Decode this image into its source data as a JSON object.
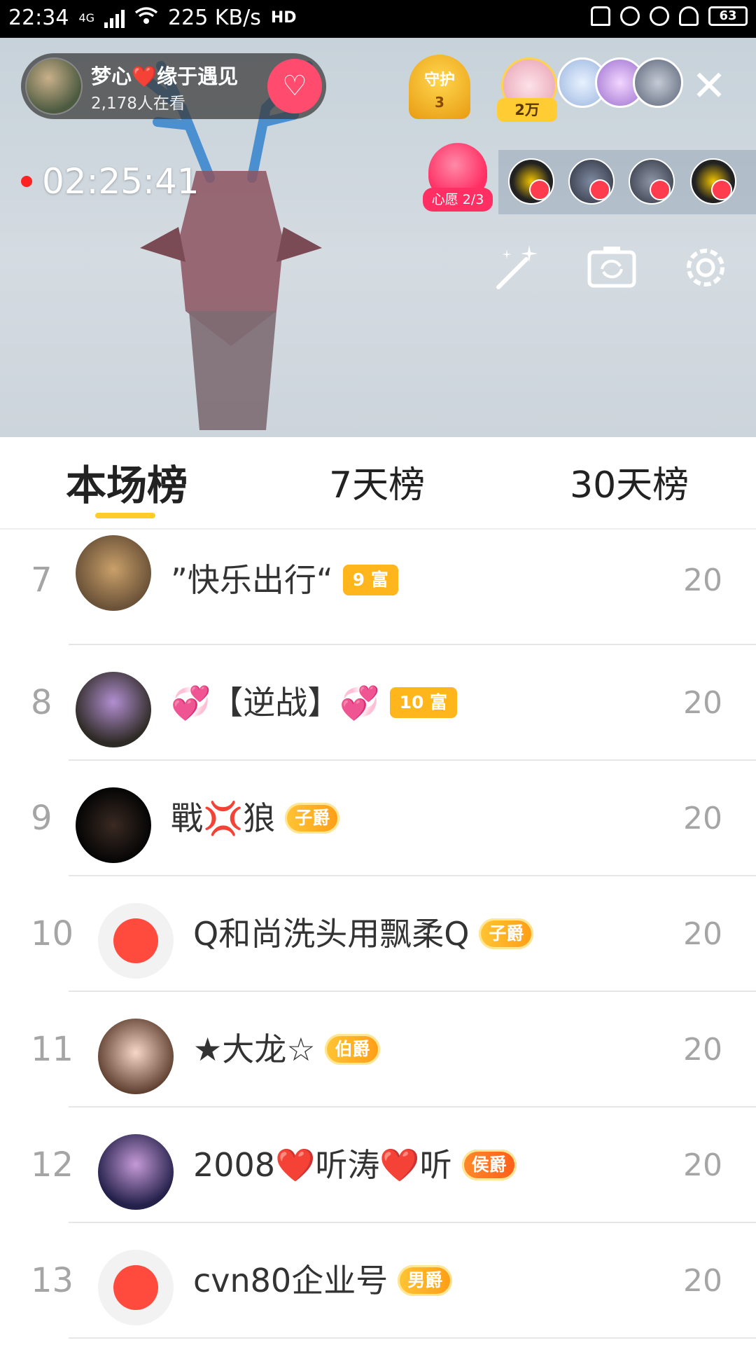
{
  "status_bar": {
    "time": "22:34",
    "network": "4G",
    "speed": "225 KB/s",
    "hd_label": "HD",
    "battery": "63",
    "icons": [
      "mute-icon",
      "lock-rotation-icon",
      "alarm-icon",
      "headphones-icon",
      "battery-icon"
    ]
  },
  "live": {
    "anchor_name": "梦心❤️缘于遇见",
    "viewers": "2,178人在看",
    "follow_icon": "heart-plus-icon",
    "guard_label": "守护",
    "guard_count": "3",
    "fan_count": "2万",
    "timer": "02:25:41",
    "wish_label": "心愿 2/3",
    "tools": [
      "magic-wand-icon",
      "camera-flip-icon",
      "settings-gear-icon"
    ],
    "colors": {
      "accent": "#ffcc29",
      "live_red": "#ff2f63"
    }
  },
  "tabs": [
    {
      "label": "本场榜",
      "active": true
    },
    {
      "label": "7天榜",
      "active": false
    },
    {
      "label": "30天榜",
      "active": false
    }
  ],
  "ranking": [
    {
      "rank": "7",
      "name": "”快乐出行“",
      "badge": "9 富",
      "badge_type": "rich",
      "score": "20"
    },
    {
      "rank": "8",
      "name": "💞【逆战】💞",
      "badge": "10 富",
      "badge_type": "rich",
      "score": "20"
    },
    {
      "rank": "9",
      "name": "戰💢狼",
      "badge": "子爵",
      "badge_type": "noble",
      "score": "20"
    },
    {
      "rank": "10",
      "name": "Q和尚洗头用飘柔Q",
      "badge": "子爵",
      "badge_type": "noble",
      "score": "20"
    },
    {
      "rank": "11",
      "name": "★大龙☆",
      "badge": "伯爵",
      "badge_type": "noble",
      "score": "20"
    },
    {
      "rank": "12",
      "name": "2008❤️听涛❤️听",
      "badge": "侯爵",
      "badge_type": "noble-hou",
      "score": "20"
    },
    {
      "rank": "13",
      "name": "cvn80企业号",
      "badge": "男爵",
      "badge_type": "noble",
      "score": "20"
    }
  ]
}
